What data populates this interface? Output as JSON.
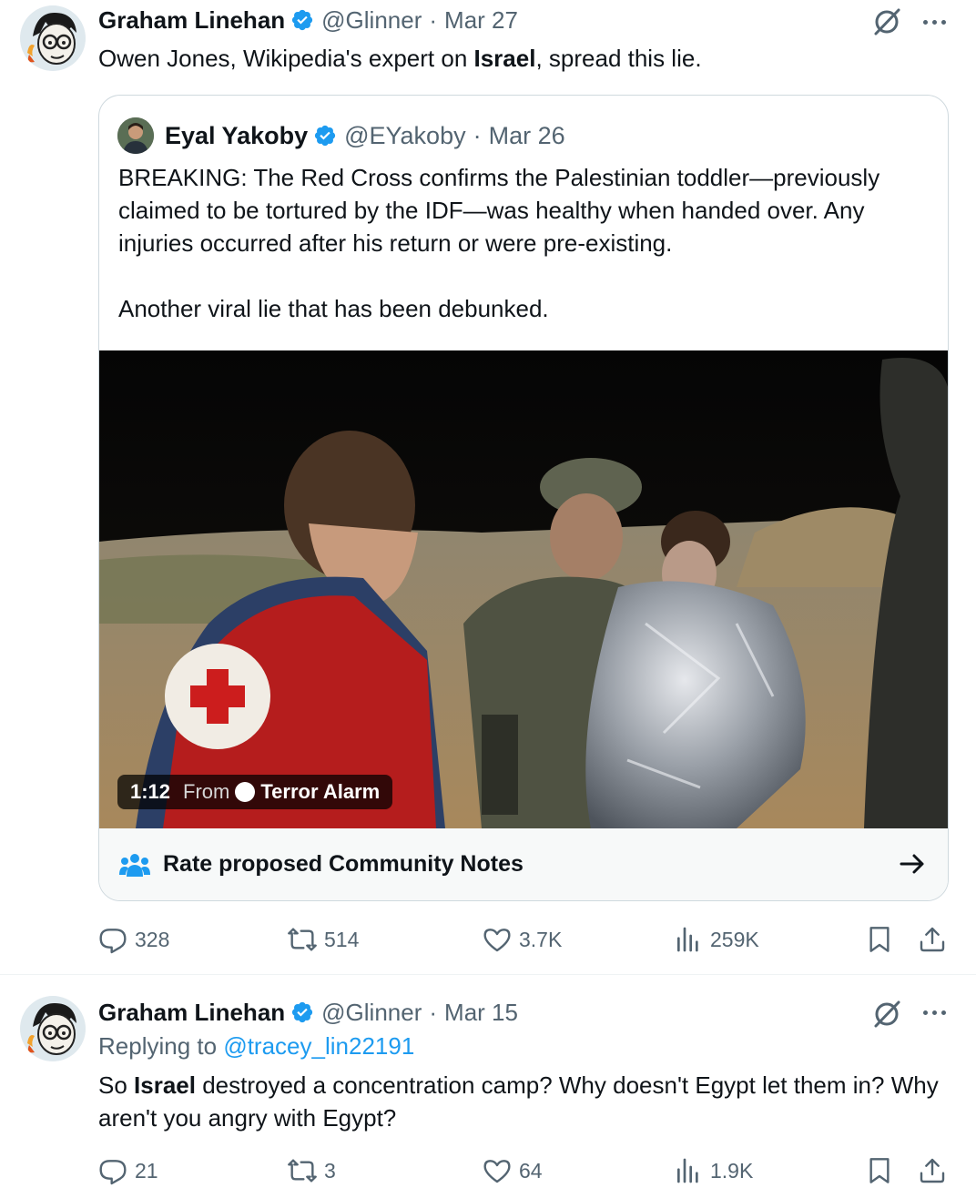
{
  "tweets": [
    {
      "author": "Graham Linehan",
      "handle": "@Glinner",
      "date": "Mar 27",
      "text_before": "Owen Jones, Wikipedia's expert on ",
      "text_bold": "Israel",
      "text_after": ", spread this lie.",
      "quote": {
        "author": "Eyal Yakoby",
        "handle": "@EYakoby",
        "date": "Mar 26",
        "paragraph1": "BREAKING: The Red Cross confirms the Palestinian toddler—previously claimed to be tortured by the IDF—was healthy when handed over. Any injuries occurred after his return or were pre-existing.",
        "paragraph2": "Another viral lie that has been debunked.",
        "video": {
          "duration": "1:12",
          "from_label": "From",
          "source": "Terror Alarm"
        },
        "community_notes_label": "Rate proposed Community Notes"
      },
      "stats": {
        "replies": "328",
        "reposts": "514",
        "likes": "3.7K",
        "views": "259K"
      }
    },
    {
      "author": "Graham Linehan",
      "handle": "@Glinner",
      "date": "Mar 15",
      "replying_label": "Replying to",
      "replying_handle": "@tracey_lin22191",
      "text_before": "So ",
      "text_bold": "Israel",
      "text_after": " destroyed a concentration camp? Why doesn't Egypt let them in? Why aren't you angry with Egypt?",
      "stats": {
        "replies": "21",
        "reposts": "3",
        "likes": "64",
        "views": "1.9K"
      }
    }
  ],
  "dot_separator": "·",
  "colors": {
    "verified": "#1d9bf0",
    "secondary": "#536471",
    "link": "#1d9bf0",
    "cn_icon": "#1d9bf0"
  },
  "icons": [
    "verified-badge-icon",
    "grok-icon",
    "more-icon",
    "reply-icon",
    "repost-icon",
    "like-icon",
    "views-icon",
    "bookmark-icon",
    "share-icon",
    "community-notes-icon",
    "arrow-right-icon"
  ]
}
